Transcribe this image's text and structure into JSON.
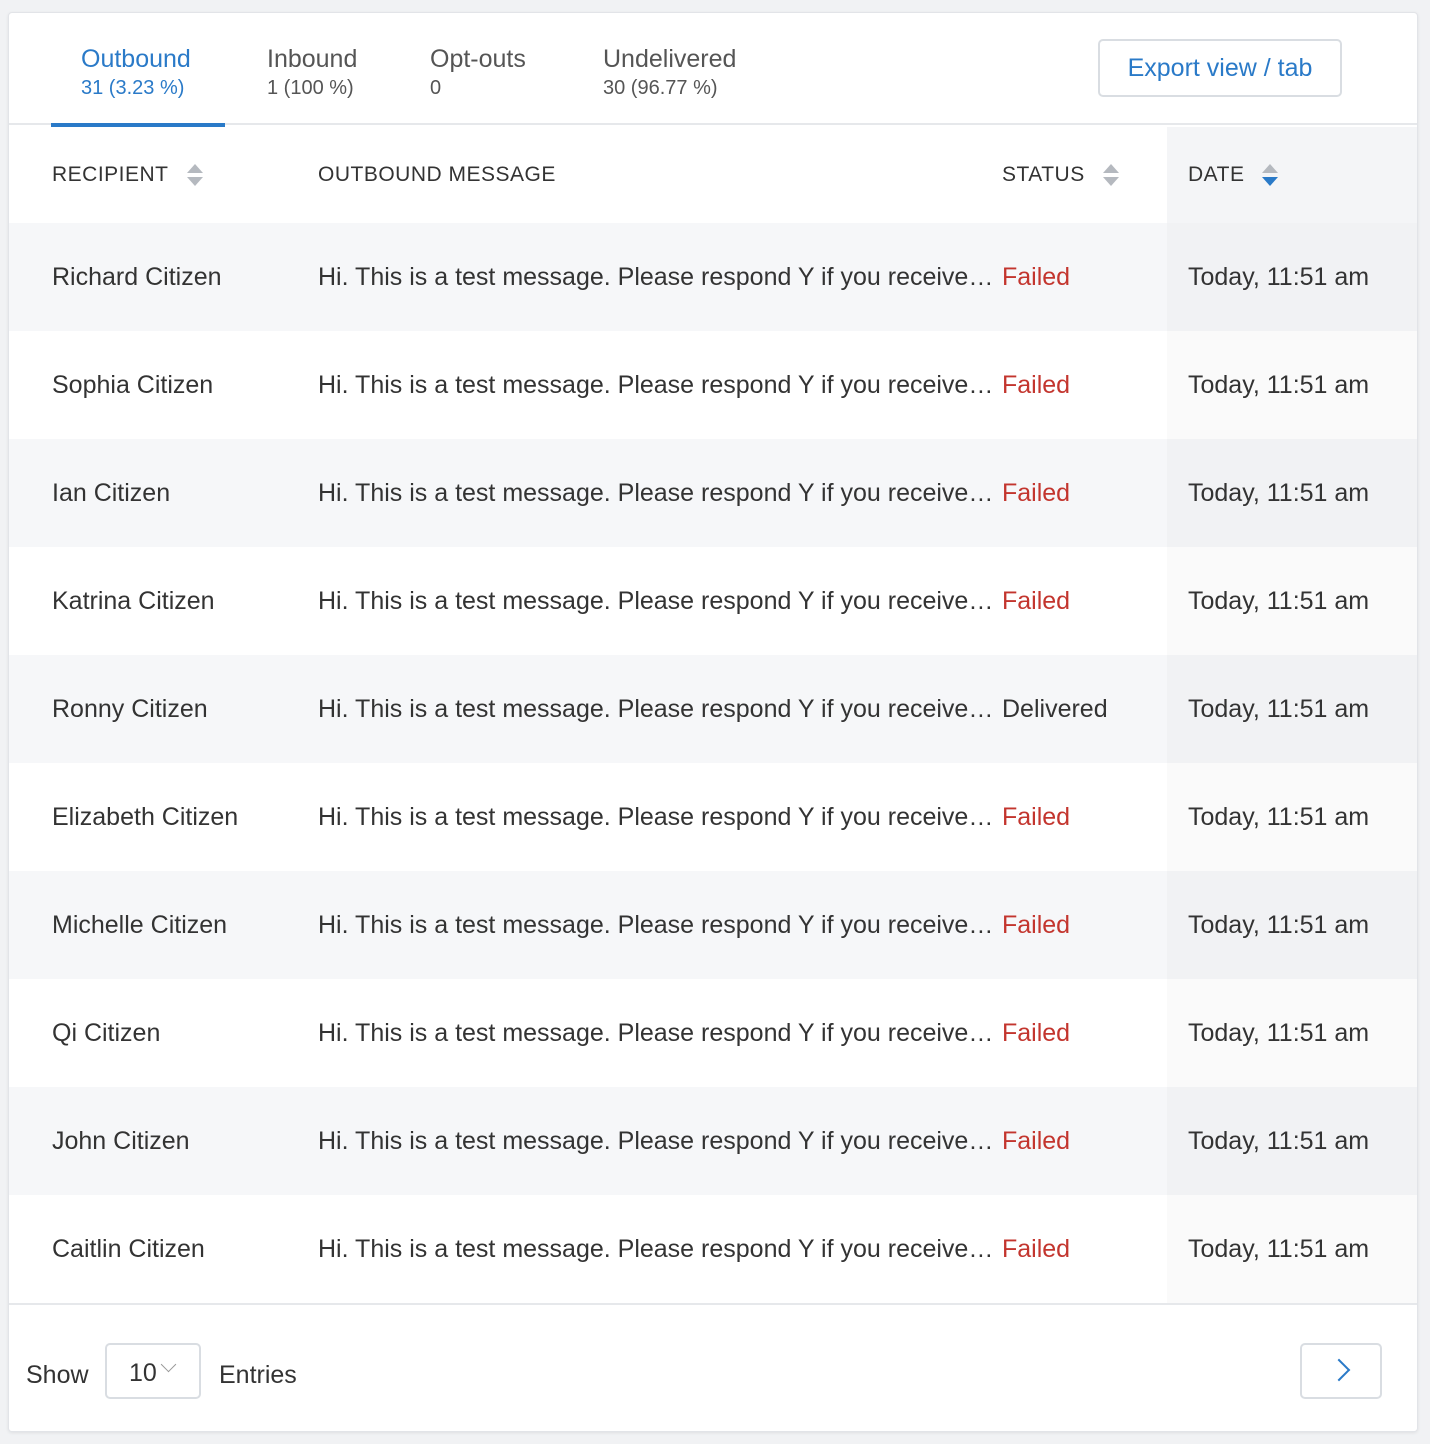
{
  "tabs": [
    {
      "label": "Outbound",
      "count": "31 (3.23 %)",
      "active": true
    },
    {
      "label": "Inbound",
      "count": "1 (100 %)",
      "active": false
    },
    {
      "label": "Opt-outs",
      "count": "0",
      "active": false
    },
    {
      "label": "Undelivered",
      "count": "30 (96.77 %)",
      "active": false
    }
  ],
  "export_label": "Export view / tab",
  "columns": {
    "recipient": "RECIPIENT",
    "message": "OUTBOUND MESSAGE",
    "status": "STATUS",
    "date": "DATE"
  },
  "rows": [
    {
      "recipient": "Richard Citizen",
      "message": "Hi. This is a test message. Please respond Y if you receive…",
      "status": "Failed",
      "date": "Today, 11:51 am"
    },
    {
      "recipient": "Sophia Citizen",
      "message": "Hi. This is a test message. Please respond Y if you receive…",
      "status": "Failed",
      "date": "Today, 11:51 am"
    },
    {
      "recipient": "Ian Citizen",
      "message": "Hi. This is a test message. Please respond Y if you receive…",
      "status": "Failed",
      "date": "Today, 11:51 am"
    },
    {
      "recipient": "Katrina Citizen",
      "message": "Hi. This is a test message. Please respond Y if you receive…",
      "status": "Failed",
      "date": "Today, 11:51 am"
    },
    {
      "recipient": "Ronny Citizen",
      "message": "Hi. This is a test message. Please respond Y if you receive…",
      "status": "Delivered",
      "date": "Today, 11:51 am"
    },
    {
      "recipient": "Elizabeth Citizen",
      "message": "Hi. This is a test message. Please respond Y if you receive…",
      "status": "Failed",
      "date": "Today, 11:51 am"
    },
    {
      "recipient": "Michelle Citizen",
      "message": "Hi. This is a test message. Please respond Y if you receive…",
      "status": "Failed",
      "date": "Today, 11:51 am"
    },
    {
      "recipient": "Qi Citizen",
      "message": "Hi. This is a test message. Please respond Y if you receive…",
      "status": "Failed",
      "date": "Today, 11:51 am"
    },
    {
      "recipient": "John Citizen",
      "message": "Hi. This is a test message. Please respond Y if you receive…",
      "status": "Failed",
      "date": "Today, 11:51 am"
    },
    {
      "recipient": "Caitlin Citizen",
      "message": "Hi. This is a test message. Please respond Y if you receive…",
      "status": "Failed",
      "date": "Today, 11:51 am"
    }
  ],
  "footer": {
    "show_label": "Show",
    "entries_value": "10",
    "entries_label": "Entries"
  },
  "colors": {
    "accent": "#2a7ac8",
    "failed": "#c3352e"
  },
  "icons": {
    "sort": "sort-icon",
    "dropdown": "chevron-down-icon",
    "next": "chevron-right-icon"
  }
}
